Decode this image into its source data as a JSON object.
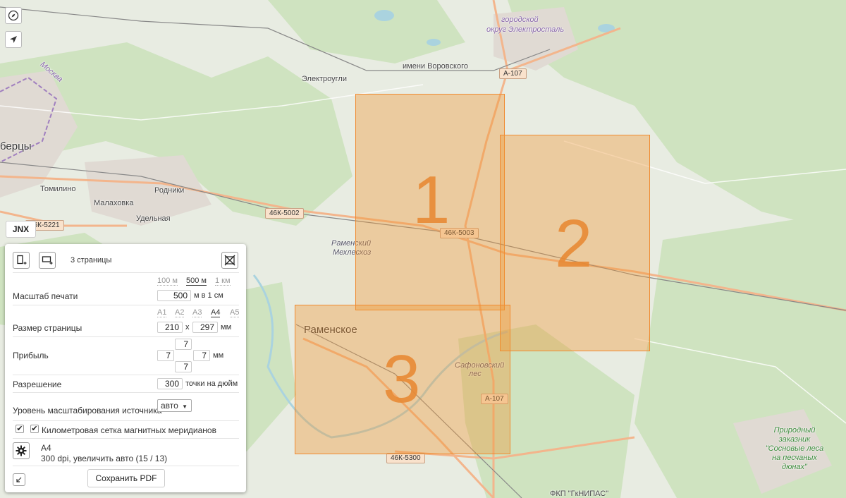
{
  "map": {
    "labels": {
      "gorodskoy": "городской",
      "okrug": "округ Электросталь",
      "vorovskogo": "имени Воровского",
      "elektrougli": "Электроугли",
      "bercy": "берцы",
      "tomilino": "Томилино",
      "rodniki": "Родники",
      "malakhovka": "Малаховка",
      "udelnaya": "Удельная",
      "mekhleskhoz1": "Раменский",
      "mekhleskhoz2": "Мехлесхоз",
      "ramenskoye": "Раменское",
      "safonovsky1": "Сафоновский",
      "safonovsky2": "лес",
      "zakaznik": "Природный заказник \"Сосновые леса на песчаных дюнах\"",
      "moskva": "Москва",
      "fkp": "ФКП \"ГкНИПАС\""
    },
    "shields": {
      "a107_top": "А-107",
      "a107_bottom": "А-107",
      "46k5002": "46К-5002",
      "46k5003": "46К-5003",
      "46k5300": "46К-5300",
      "46k5221": "46К-5221"
    },
    "pages": [
      "1",
      "2",
      "3"
    ]
  },
  "controls": {
    "compass_icon": "compass-icon",
    "locate_icon": "location-arrow-icon",
    "jnx_tab": "JNX"
  },
  "panel": {
    "page_count": "3 страницы",
    "scale": {
      "label": "Масштаб печати",
      "options": [
        "100 м",
        "500 м",
        "1 км"
      ],
      "selected": "500 м",
      "value": "500",
      "unit": "м в 1 см"
    },
    "page_size": {
      "label": "Размер страницы",
      "options": [
        "A1",
        "A2",
        "A3",
        "A4",
        "A5"
      ],
      "selected": "A4",
      "width": "210",
      "times": "x",
      "height": "297",
      "unit": "мм"
    },
    "margin": {
      "label": "Прибыль",
      "top": "7",
      "left": "7",
      "right": "7",
      "bottom": "7",
      "unit": "мм"
    },
    "resolution": {
      "label": "Разрешение",
      "value": "300",
      "unit": "точки на дюйм"
    },
    "zoom": {
      "label": "Уровень масштабирования источника",
      "value": "авто"
    },
    "grid": {
      "label": "Километровая сетка магнитных меридианов",
      "checked": true,
      "outer_checked": true
    },
    "summary": {
      "line1": "A4",
      "line2": "300 dpi, увеличить авто (15 / 13)"
    },
    "save_label": "Сохранить PDF"
  },
  "colors": {
    "accent": "#f08a30",
    "page_fill": "#f0a050",
    "forest": "#cde4bd",
    "urban": "#e2dcd4",
    "road": "#f4b890"
  }
}
